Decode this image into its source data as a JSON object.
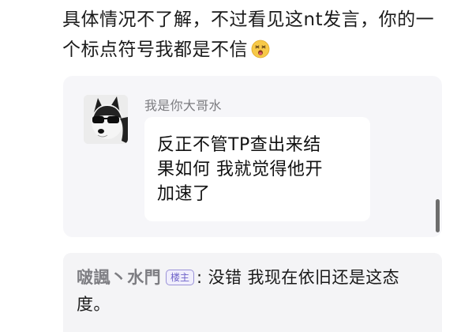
{
  "post": {
    "text": "具体情况不了解，不过看见这nt发言，你的一个标点符号我都是不信",
    "emoji_icon": "dizzy-face-emoji"
  },
  "quote": {
    "sender_name": "我是你大哥水",
    "message_lines": [
      "反正不管TP查出来结",
      "果如何  我就觉得他开",
      "加速了"
    ]
  },
  "reply": {
    "author": "啵諷丶水門",
    "badge": "楼主",
    "separator": ":",
    "content": "没错 我现在依旧还是这态度。"
  }
}
